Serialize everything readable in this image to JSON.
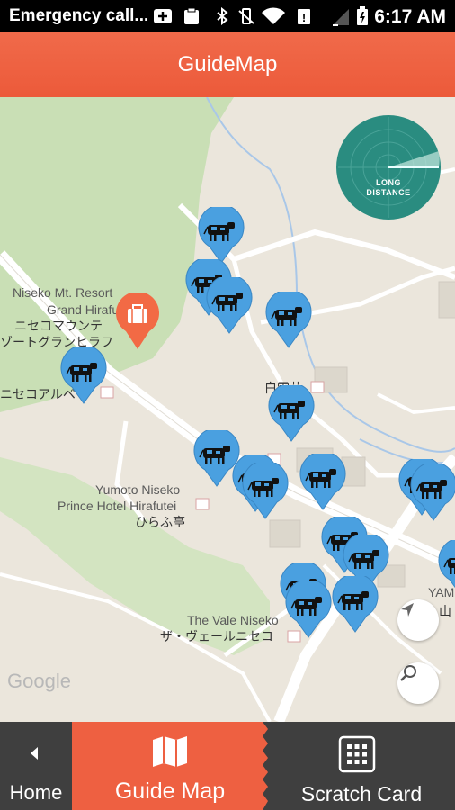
{
  "status_bar": {
    "notification": "Emergency call...",
    "time": "6:17 AM"
  },
  "header": {
    "title": "GuideMap"
  },
  "map": {
    "labels": {
      "niseko_mt_en1": "Niseko Mt. Resort",
      "niseko_mt_en2": "Grand Hirafu",
      "niseko_mt_jp1": "ニセコマウンテ",
      "niseko_mt_jp2": "ゾートグランヒラフ",
      "niseko_alpen": "ニセコアルペ",
      "hakuunso": "白雲荘",
      "yumoto_en1": "Yumoto Niseko",
      "yumoto_en2": "Prince Hotel Hirafutei",
      "yumoto_jp": "ひらふ亭",
      "vale_en": "The Vale Niseko",
      "vale_jp": "ザ・ヴェールニセコ",
      "yam": "YAM",
      "yam_jp": "山"
    },
    "attribution": "Google",
    "radar": {
      "line1": "LONG",
      "line2": "DISTANCE"
    },
    "icons": {
      "locate": "navigation-arrow-icon",
      "search": "search-icon",
      "poi": "suitcase-icon"
    },
    "pin_color": "#4aa0e0",
    "poi_color": "#f26a45"
  },
  "tabs": [
    {
      "label": "Home",
      "icon": "back-arrow-icon"
    },
    {
      "label": "Guide Map",
      "icon": "map-icon"
    },
    {
      "label": "Scratch Card",
      "icon": "grid-icon"
    }
  ],
  "colors": {
    "header": "#ec5a3a",
    "active_tab": "#ee6041",
    "tabbar": "#3f3f3f",
    "radar": "#2a8c80"
  }
}
